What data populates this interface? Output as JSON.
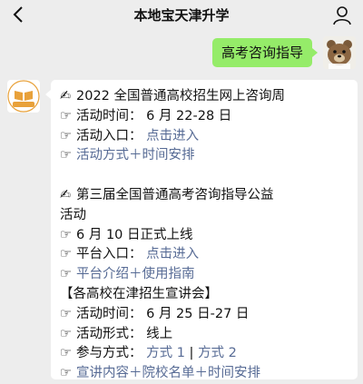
{
  "nav": {
    "back_icon": "chevron-left-icon",
    "title": "本地宝天津升学",
    "profile_icon": "person-icon"
  },
  "outgoing": {
    "text": "高考咨询指导"
  },
  "bot": {
    "avatar_text": "天津升学"
  },
  "message": {
    "s1_title": "2022 全国普通高校招生网上咨询周",
    "s1_time_label": "活动时间：",
    "s1_time_value": "6 月 22-28 日",
    "s1_entry_label": "活动入口：",
    "s1_entry_link": "点击进入",
    "s1_method_link": "活动方式＋时间安排",
    "s2_title_a": "第三届全国普通高考咨询指导公益",
    "s2_title_b": "活动",
    "s2_online": "6 月 10 日正式上线",
    "s2_entry_label": "平台入口：",
    "s2_entry_link": "点击进入",
    "s2_intro_link": "平台介绍＋使用指南",
    "s3_title": "【各高校在津招生宣讲会】",
    "s3_time_label": "活动时间：",
    "s3_time_value": "6 月 25 日-27 日",
    "s3_form_label": "活动形式：",
    "s3_form_value": "线上",
    "s3_join_label": "参与方式：",
    "s3_join_link1": "方式 1",
    "s3_join_sep": " | ",
    "s3_join_link2": "方式 2",
    "s3_content_link": "宣讲内容＋院校名单＋时间安排"
  },
  "icons": {
    "title_marker": "✍",
    "pointer": "☞"
  },
  "colors": {
    "background": "#ededed",
    "outgoing_bubble": "#95ec69",
    "link": "#576b95",
    "bot_avatar_accent": "#e8a13a"
  }
}
